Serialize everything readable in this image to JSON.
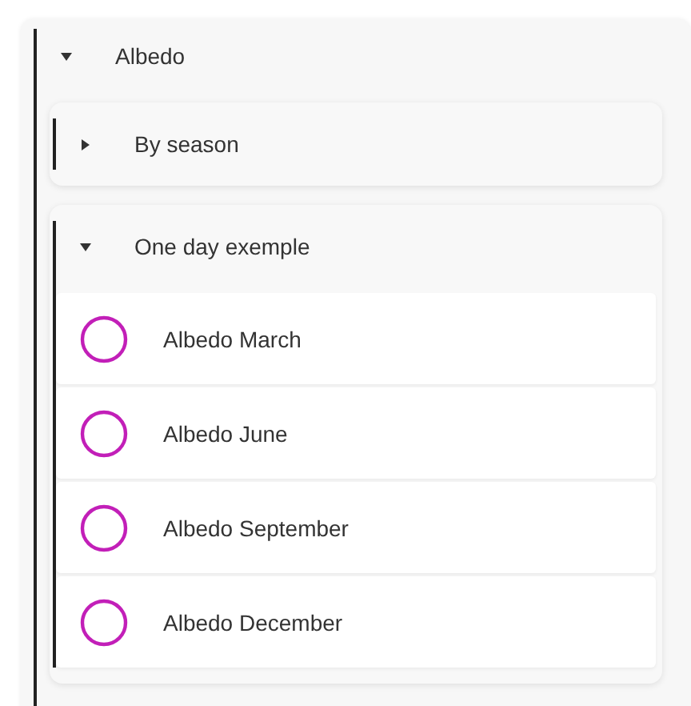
{
  "tree": {
    "label": "Albedo",
    "expanded": true,
    "children": [
      {
        "kind": "group",
        "label": "By season",
        "expanded": false
      },
      {
        "kind": "group",
        "label": "One day exemple",
        "expanded": true,
        "children": [
          {
            "kind": "layer",
            "label": "Albedo March",
            "selected": false
          },
          {
            "kind": "layer",
            "label": "Albedo June",
            "selected": false
          },
          {
            "kind": "layer",
            "label": "Albedo September",
            "selected": false
          },
          {
            "kind": "layer",
            "label": "Albedo December",
            "selected": false
          }
        ]
      }
    ]
  }
}
